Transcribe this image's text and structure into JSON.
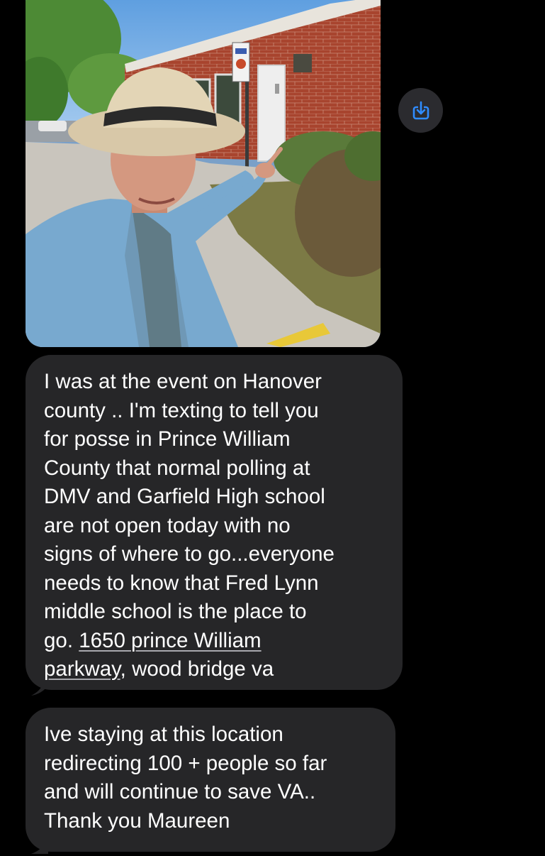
{
  "photo": {
    "alt": "Man in straw cowboy hat and light blue blazer pointing at a brick building with a sign on a post"
  },
  "actions": {
    "save_icon": "save-download-icon",
    "accent_color": "#2f8cff"
  },
  "messages": [
    {
      "lines": [
        "I was at the event on Hanover",
        "county .. I'm texting to tell you",
        "for posse in Prince William",
        "County that normal polling at",
        "DMV and Garfield High school",
        "are not open today with no",
        "signs of where to go...everyone",
        "needs to know that Fred Lynn",
        "middle school is the place to"
      ],
      "line_10_prefix": "go. ",
      "address_part_1": "1650 prince William",
      "address_part_2": "parkway",
      "line_11_suffix": ", wood bridge va"
    },
    {
      "lines": [
        "Ive staying at this location",
        "redirecting 100 + people so far",
        "and will continue to save VA..",
        "Thank you Maureen"
      ]
    }
  ],
  "colors": {
    "background": "#000000",
    "bubble": "#262628",
    "text": "#ffffff"
  }
}
